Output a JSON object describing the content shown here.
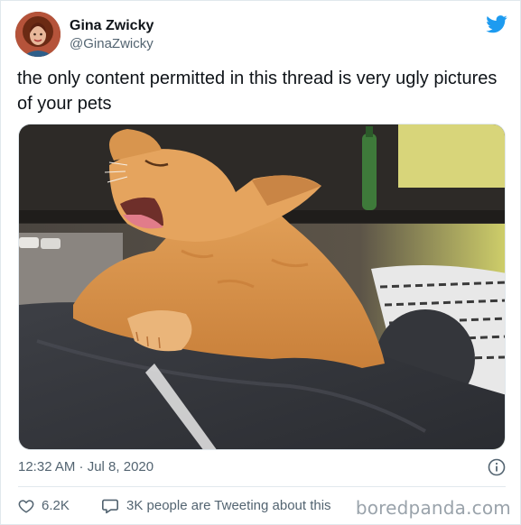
{
  "author": {
    "display_name": "Gina Zwicky",
    "handle": "@GinaZwicky",
    "avatar_icon": "profile-photo"
  },
  "tweet": {
    "text": "the only content permitted in this thread is very ugly pictures of your pets"
  },
  "media": {
    "description_icon": "yawning-orange-kitten-photo"
  },
  "meta": {
    "timestamp": "12:32 AM · Jul 8, 2020",
    "info_icon": "info-icon"
  },
  "actions": {
    "likes": "6.2K",
    "replies_text": "3K people are Tweeting about this"
  },
  "watermark": "boredpanda.com",
  "colors": {
    "twitter_blue": "#1d9bf0",
    "secondary_text": "#536471"
  }
}
